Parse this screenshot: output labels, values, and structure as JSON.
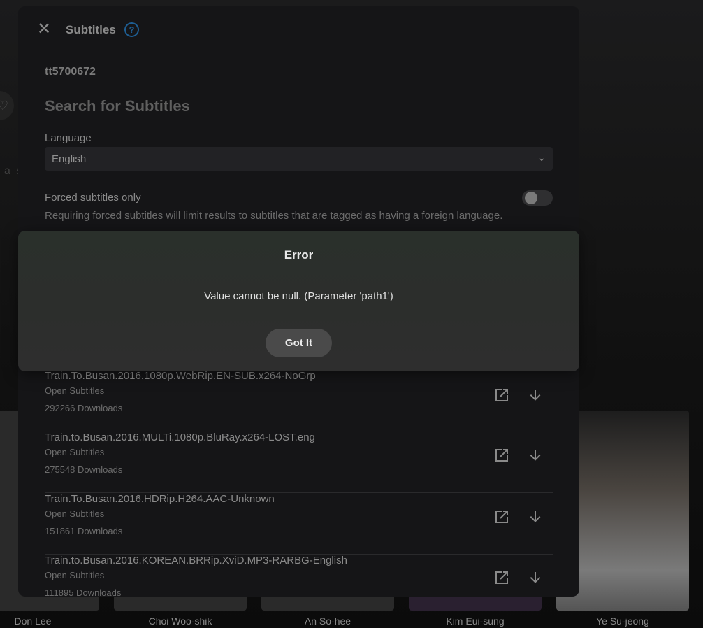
{
  "background": {
    "partial_text": "a s",
    "cast": [
      "Don Lee",
      "Choi Woo-shik",
      "An So-hee",
      "Kim Eui-sung",
      "Ye Su-jeong"
    ]
  },
  "dialog": {
    "title": "Subtitles",
    "imdb_id": "tt5700672",
    "heading": "Search for Subtitles",
    "language_label": "Language",
    "language_value": "English",
    "forced_label": "Forced subtitles only",
    "forced_enabled": false,
    "forced_help": "Requiring forced subtitles will limit results to subtitles that are tagged as having a foreign language.",
    "results": [
      {
        "name": "Train.To.Busan.2016.1080p.WebRip.EN-SUB.x264-NoGrp",
        "source": "Open Subtitles",
        "downloads": "292266 Downloads"
      },
      {
        "name": "Train.to.Busan.2016.MULTi.1080p.BluRay.x264-LOST.eng",
        "source": "Open Subtitles",
        "downloads": "275548 Downloads"
      },
      {
        "name": "Train.To.Busan.2016.HDRip.H264.AAC-Unknown",
        "source": "Open Subtitles",
        "downloads": "151861 Downloads"
      },
      {
        "name": "Train.to.Busan.2016.KOREAN.BRRip.XviD.MP3-RARBG-English",
        "source": "Open Subtitles",
        "downloads": "111895 Downloads"
      }
    ]
  },
  "error": {
    "title": "Error",
    "message": "Value cannot be null. (Parameter 'path1')",
    "button": "Got It"
  }
}
